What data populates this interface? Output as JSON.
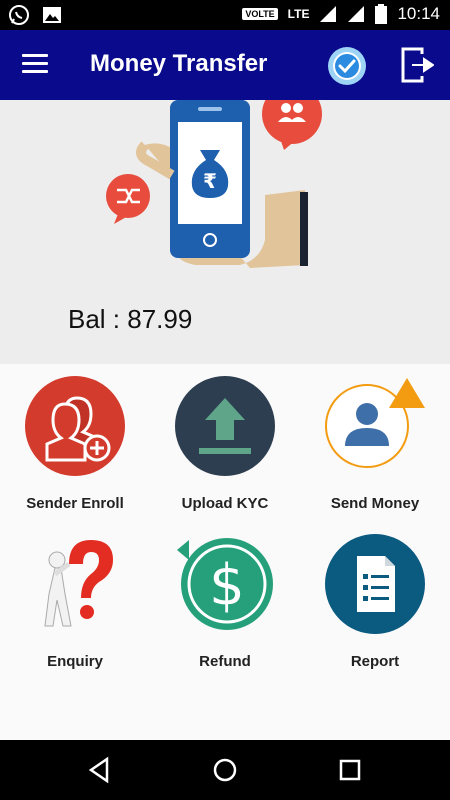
{
  "status_bar": {
    "volte": "VOLTE",
    "network": "LTE",
    "time": "10:14",
    "icons": [
      "whatsapp-icon",
      "image-icon",
      "signal-icon",
      "signal-icon",
      "battery-icon"
    ]
  },
  "app_bar": {
    "title": "Money Transfer",
    "icons": [
      "menu-icon",
      "verified-check-icon",
      "logout-icon"
    ]
  },
  "hero": {
    "illustration": "phone-in-hand-rupee-illustration",
    "currency_symbol": "₹",
    "balance_text": "Bal : 87.99"
  },
  "menu": {
    "items": [
      {
        "label": "Sender Enroll",
        "icon": "add-user-icon"
      },
      {
        "label": "Upload KYC",
        "icon": "upload-icon"
      },
      {
        "label": "Send Money",
        "icon": "user-warning-icon"
      },
      {
        "label": "Enquiry",
        "icon": "question-icon"
      },
      {
        "label": "Refund",
        "icon": "refund-dollar-icon"
      },
      {
        "label": "Report",
        "icon": "report-document-icon"
      }
    ]
  },
  "colors": {
    "app_bar": "#0a0a8c",
    "accent_red": "#d33b2c",
    "accent_teal": "#26a07a",
    "accent_navy": "#0b5a80",
    "accent_orange": "#f39c12"
  }
}
